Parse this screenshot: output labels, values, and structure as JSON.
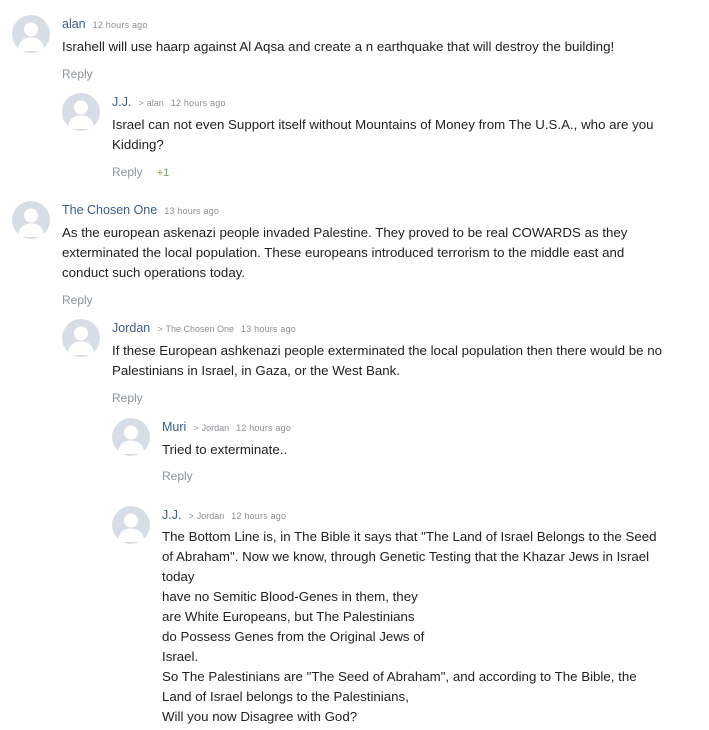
{
  "comments": [
    {
      "author": "alan",
      "reply_arrow": "",
      "reply_to": "",
      "time": "12 hours ago",
      "lines": [
        "Israhell will use haarp against Al Aqsa and create a n earthquake that will destroy the building!"
      ],
      "reply_label": "Reply",
      "votes": ""
    },
    {
      "author": "J.J.",
      "reply_arrow": ">",
      "reply_to": "alan",
      "time": "12 hours ago",
      "lines": [
        "Israel can not even Support itself without Mountains of Money from The U.S.A., who are you",
        "Kidding?"
      ],
      "reply_label": "Reply",
      "votes": "+1"
    },
    {
      "author": "The Chosen One",
      "reply_arrow": "",
      "reply_to": "",
      "time": "13 hours ago",
      "lines": [
        "As the european askenazi people invaded Palestine. They proved to be real COWARDS as they",
        "exterminated the local population. These europeans introduced terrorism to the middle east and",
        "conduct such operations today."
      ],
      "reply_label": "Reply",
      "votes": ""
    },
    {
      "author": "Jordan",
      "reply_arrow": ">",
      "reply_to": "The Chosen One",
      "time": "13 hours ago",
      "lines": [
        "If these European ashkenazi people exterminated the local population then there would be no",
        "Palestinians in Israel, in Gaza, or the West Bank."
      ],
      "reply_label": "Reply",
      "votes": ""
    },
    {
      "author": "Muri",
      "reply_arrow": ">",
      "reply_to": "Jordan",
      "time": "12 hours ago",
      "lines": [
        "Tried to exterminate.."
      ],
      "reply_label": "Reply",
      "votes": ""
    },
    {
      "author": "J.J.",
      "reply_arrow": ">",
      "reply_to": "Jordan",
      "time": "12 hours ago",
      "lines": [
        "The Bottom Line is, in The Bible it says that \"The Land of Israel Belongs to the Seed",
        "of Abraham\". Now we know, through Genetic Testing that the Khazar Jews in Israel",
        "today",
        "have no Semitic Blood-Genes in them, they",
        "are White Europeans, but The Palestinians",
        "do Possess Genes from the Original Jews of",
        "Israel.",
        "So The Palestinians are \"The Seed of Abraham\", and according to The Bible, the",
        "Land of Israel belongs to the Palestinians,",
        "Will you now Disagree with God?"
      ],
      "reply_label": "",
      "votes": ""
    }
  ]
}
